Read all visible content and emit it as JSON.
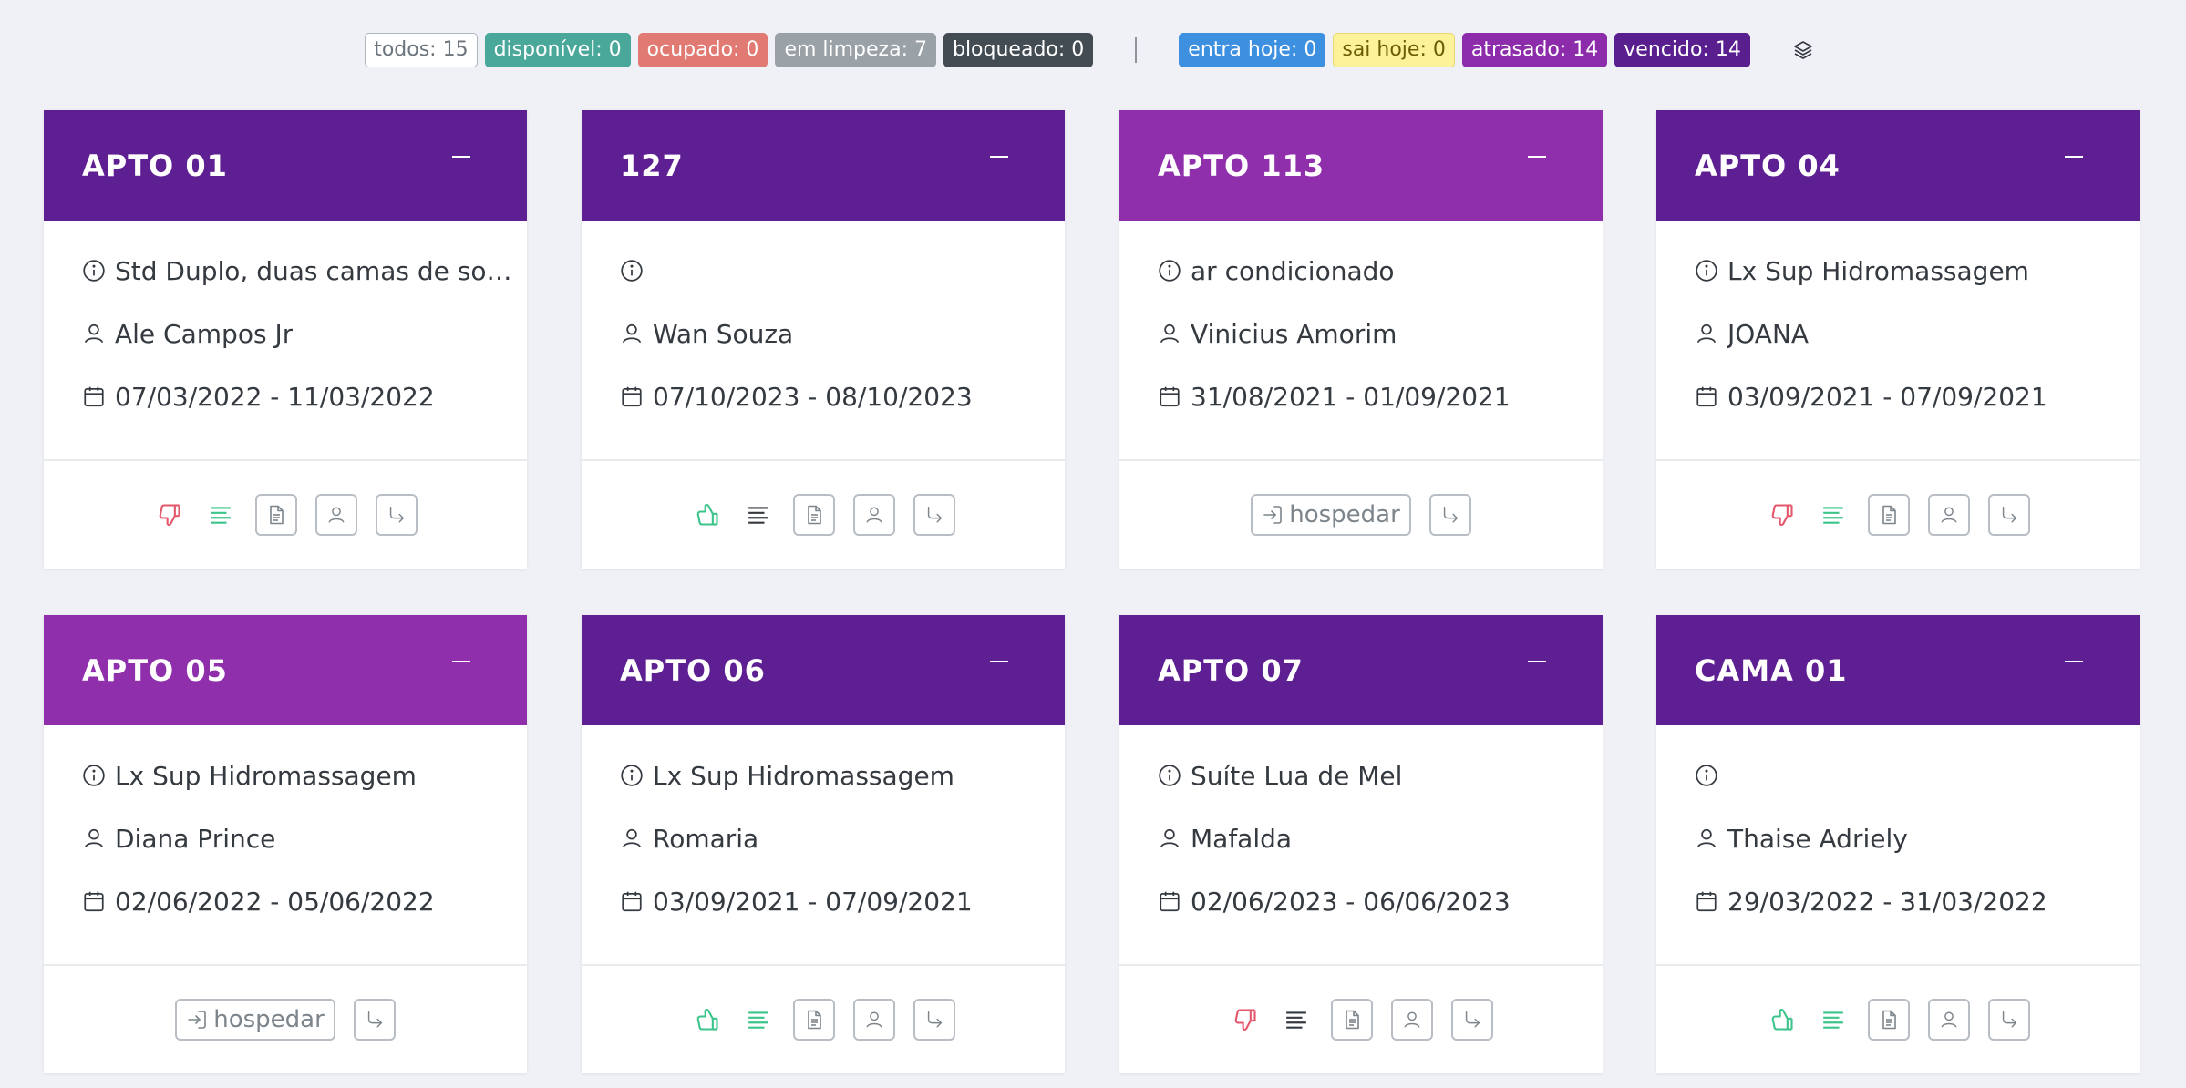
{
  "filters": {
    "todos": "todos: 15",
    "disponivel": "disponível: 0",
    "ocupado": "ocupado: 0",
    "em_limpeza": "em limpeza: 7",
    "bloqueado": "bloqueado: 0",
    "entra_hoje": "entra hoje: 0",
    "sai_hoje": "sai hoje: 0",
    "atrasado": "atrasado: 14",
    "vencido": "vencido: 14",
    "layers_icon": "layers-icon"
  },
  "colors": {
    "header_dark": "#5e1f93",
    "header_light": "#8f2fac",
    "thumb_up": "#3cc48a",
    "thumb_down": "#e4566b",
    "lines_green": "#3cc48a"
  },
  "cards": [
    {
      "title": "APTO 01",
      "info": "Std Duplo, duas camas de sol...",
      "guest": "Ale Campos Jr",
      "dates": "07/03/2022 - 11/03/2022",
      "action_label": ""
    },
    {
      "title": "127",
      "info": "",
      "guest": "Wan Souza",
      "dates": "07/10/2023 - 08/10/2023",
      "action_label": ""
    },
    {
      "title": "APTO 113",
      "info": "ar condicionado",
      "guest": "Vinicius Amorim",
      "dates": "31/08/2021 - 01/09/2021",
      "action_label": "hospedar"
    },
    {
      "title": "APTO 04",
      "info": "Lx Sup Hidromassagem",
      "guest": "JOANA",
      "dates": "03/09/2021 - 07/09/2021",
      "action_label": ""
    },
    {
      "title": "APTO 05",
      "info": "Lx Sup Hidromassagem",
      "guest": "Diana Prince",
      "dates": "02/06/2022 - 05/06/2022",
      "action_label": "hospedar"
    },
    {
      "title": "APTO 06",
      "info": "Lx Sup Hidromassagem",
      "guest": "Romaria",
      "dates": "03/09/2021 - 07/09/2021",
      "action_label": ""
    },
    {
      "title": "APTO 07",
      "info": "Suíte Lua de Mel",
      "guest": "Mafalda",
      "dates": "02/06/2023 - 06/06/2023",
      "action_label": ""
    },
    {
      "title": "CAMA 01",
      "info": "",
      "guest": "Thaise Adriely",
      "dates": "29/03/2022 - 31/03/2022",
      "action_label": ""
    }
  ]
}
